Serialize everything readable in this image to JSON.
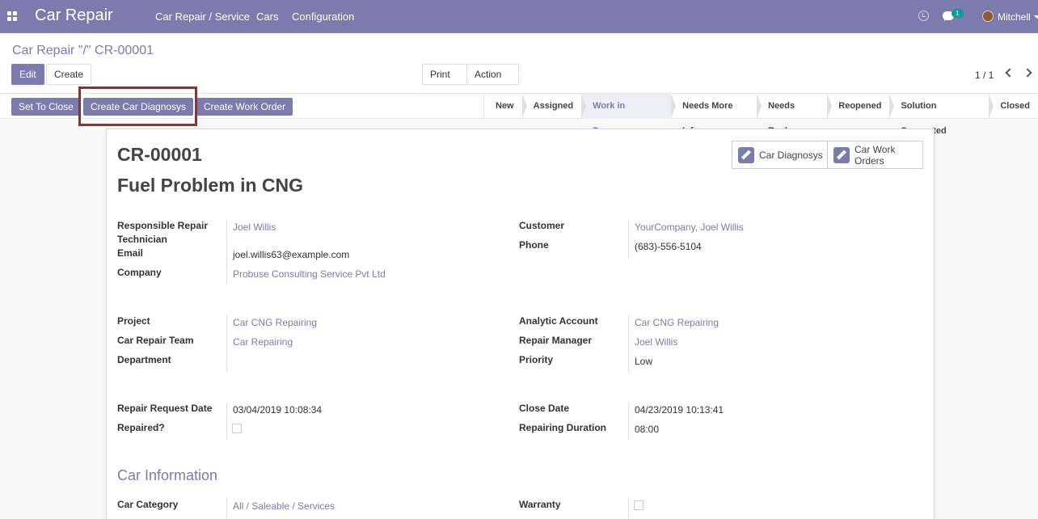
{
  "nav": {
    "app_name": "Car Repair",
    "menu": [
      "Car Repair / Service",
      "Cars",
      "Configuration"
    ],
    "message_count": "1",
    "user": "Mitchell"
  },
  "breadcrumb": "Car Repair \"/\" CR-00001",
  "buttons": {
    "edit": "Edit",
    "create": "Create",
    "print": "Print",
    "action": "Action"
  },
  "pager": "1 / 1",
  "header_buttons": [
    "Set To Close",
    "Create Car Diagnosys",
    "Create Work Order"
  ],
  "stages": [
    "New",
    "Assigned",
    "Work in Progress",
    "Needs More Info",
    "Needs Reply",
    "Reopened",
    "Solution Suggested",
    "Closed"
  ],
  "active_stage": "Work in Progress",
  "smart_buttons": {
    "diagnosys": "Car Diagnosys",
    "work_orders_line1": "Car Work",
    "work_orders_line2": "Orders"
  },
  "record": {
    "code": "CR-00001",
    "title": "Fuel Problem in CNG"
  },
  "labels": {
    "technician": "Responsible Repair Technician",
    "email": "Email",
    "company": "Company",
    "customer": "Customer",
    "phone": "Phone",
    "project": "Project",
    "team": "Car Repair Team",
    "department": "Department",
    "analytic": "Analytic Account",
    "manager": "Repair Manager",
    "priority": "Priority",
    "request_date": "Repair Request Date",
    "repaired": "Repaired?",
    "close_date": "Close Date",
    "duration": "Repairing Duration",
    "car_category": "Car Category",
    "warranty": "Warranty"
  },
  "values": {
    "technician": "Joel Willis",
    "email": "joel.willis63@example.com",
    "company": "Probuse Consulting Service Pvt Ltd",
    "customer": "YourCompany, Joel Willis",
    "phone": "(683)-556-5104",
    "project": "Car CNG Repairing",
    "team": "Car Repairing",
    "analytic": "Car CNG Repairing",
    "manager": "Joel Willis",
    "priority": "Low",
    "request_date": "03/04/2019 10:08:34",
    "close_date": "04/23/2019 10:13:41",
    "duration": "08:00",
    "car_category": "All / Saleable / Services"
  },
  "section_car_info": "Car Information"
}
